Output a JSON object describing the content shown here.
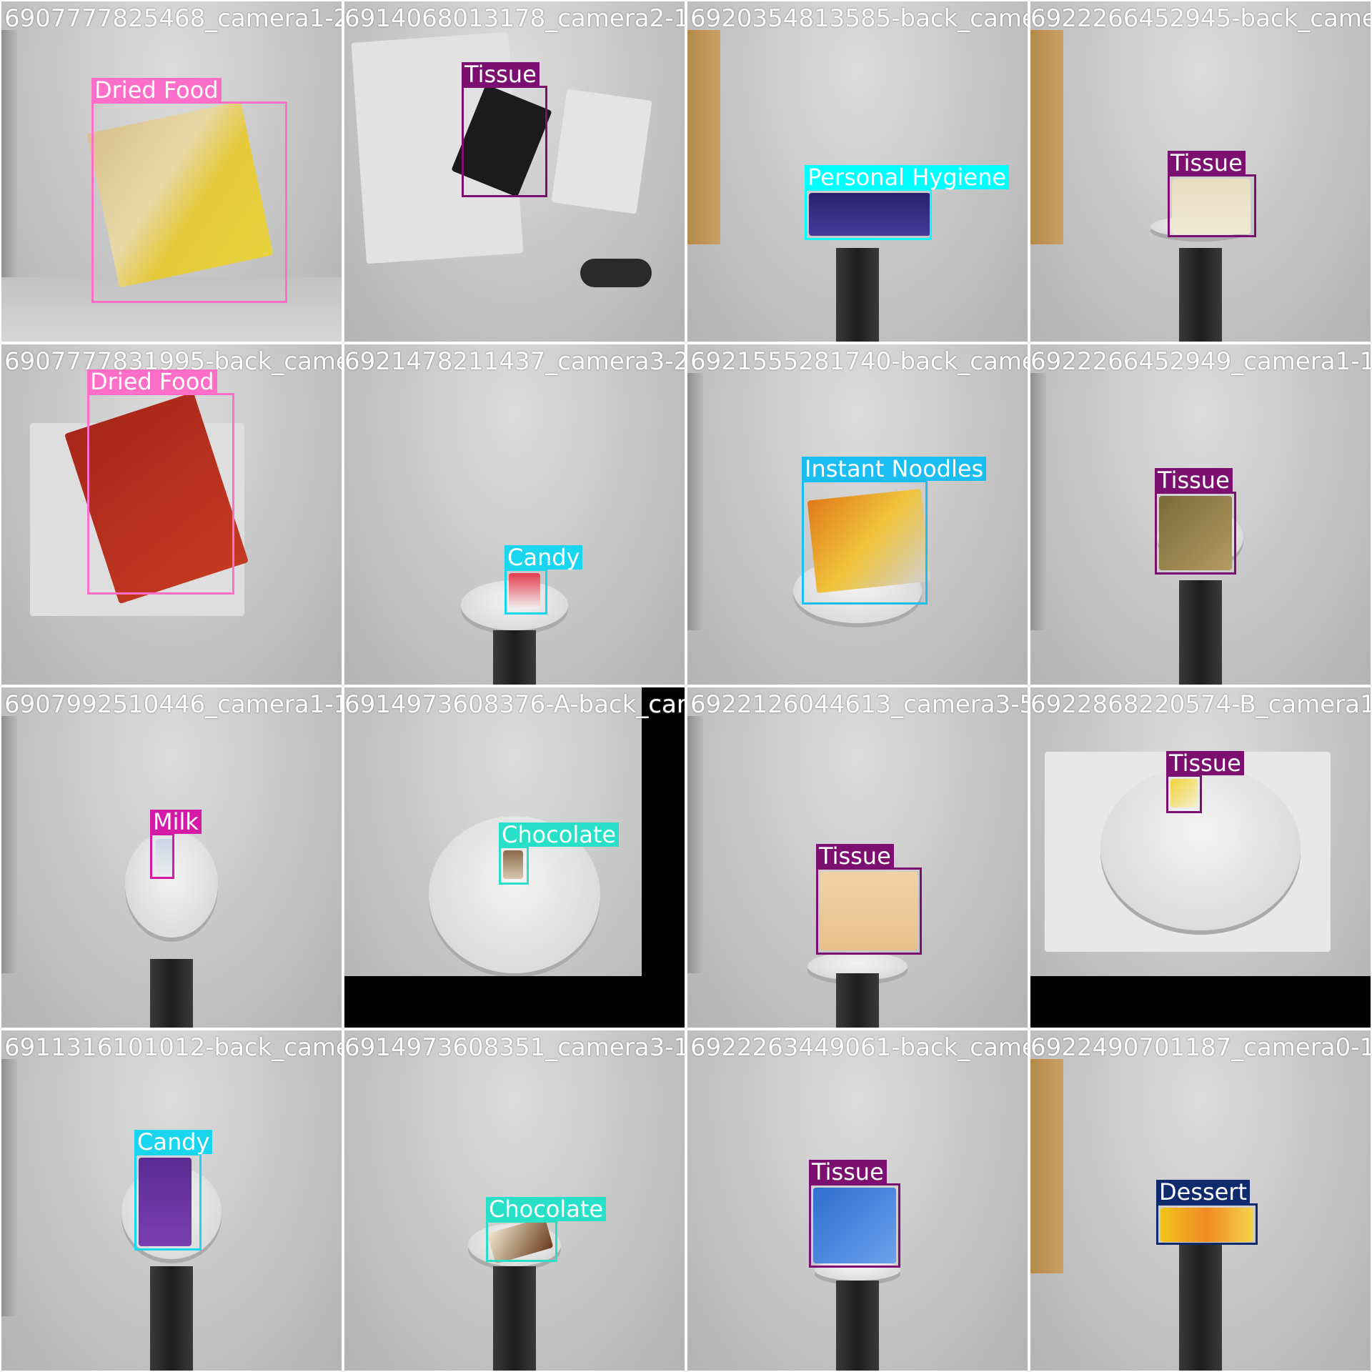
{
  "colors": {
    "Dried Food": "#ff6ec7",
    "Tissue": "#7b1070",
    "Personal Hygiene": "#00ffff",
    "Candy": "#19d5ee",
    "Instant Noodles": "#1cbdf0",
    "Milk": "#d61aa8",
    "Chocolate": "#28e0c8",
    "Dessert": "#102a6e"
  },
  "tiles": [
    {
      "filename": "6907777825468_camera1-22_jpg.rf.81d1c75",
      "label": "Dried Food"
    },
    {
      "filename": "6914068013178_camera2-15_jpg.rf.2931c5",
      "label": "Tissue"
    },
    {
      "filename": "6920354813585-back_camera2-2_jpg.rf.4d5b1",
      "label": "Personal Hygiene"
    },
    {
      "filename": "6922266452945-back_camera0-1_jpg.rf.a3e",
      "label": "Tissue"
    },
    {
      "filename": "6907777831995-back_camera2-4_jpg.rf.87fb",
      "label": "Dried Food"
    },
    {
      "filename": "6921478211437_camera3-21_jpg.rf.17d7f",
      "label": "Candy"
    },
    {
      "filename": "6921555281740-back_camera1-5_jpg.rf.b6d6",
      "label": "Instant Noodles"
    },
    {
      "filename": "6922266452949_camera1-12_jpg.rf.a2e4e",
      "label": "Tissue"
    },
    {
      "filename": "6907992510446_camera1-16_jpg.rf.13f8d3",
      "label": "Milk"
    },
    {
      "filename": "6914973608376-A-back_camera2-1_jpg.rf.b6c",
      "label": "Chocolate"
    },
    {
      "filename": "6922126044613_camera3-56_jpg.rf.18d4",
      "label": "Tissue"
    },
    {
      "filename": "6922868220574-B_camera1-28_jpg.rf.f3",
      "label": "Tissue"
    },
    {
      "filename": "6911316101012-back_camera1-4_jpg.rf.5b",
      "label": "Candy"
    },
    {
      "filename": "6914973608351_camera3-15_jpg.rf.37a1",
      "label": "Chocolate"
    },
    {
      "filename": "6922263449061-back_camera0-1_jpg.rf.15",
      "label": "Tissue"
    },
    {
      "filename": "6922490701187_camera0-15_jpg.rf.d1d3",
      "label": "Dessert"
    }
  ]
}
